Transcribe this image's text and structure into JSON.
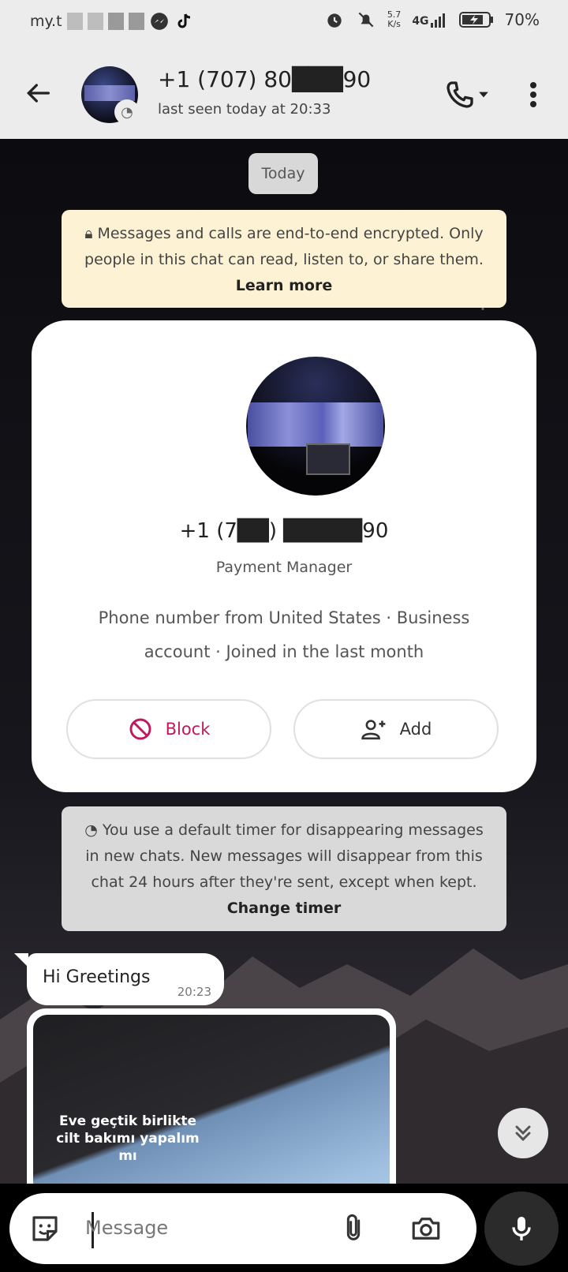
{
  "status_bar": {
    "left_text": "my.t",
    "speed_value": "5.7",
    "speed_unit": "K/s",
    "network": "4G",
    "battery": "70%"
  },
  "header": {
    "contact_name": "+1 (707) 80███90",
    "last_seen": "last seen today at 20:33"
  },
  "chat": {
    "date_chip": "Today",
    "encryption_notice": "Messages and calls are end-to-end encrypted. Only people in this chat can read, listen to, or share them.",
    "encryption_link": "Learn more",
    "contact_card": {
      "phone": "+1 (7██) █████90",
      "role": "Payment Manager",
      "meta_line1": "Phone number from United States  ·  Business",
      "meta_line2": "account  ·  Joined in the last month",
      "block_label": "Block",
      "add_label": "Add"
    },
    "timer_notice": "You use a default timer for disappearing messages in new chats. New messages will disappear from this chat 24 hours after they're sent, except when kept.",
    "timer_link": "Change timer",
    "messages": [
      {
        "text": "Hi Greetings",
        "time": "20:23"
      }
    ],
    "media_caption": "Eve geçtik birlikte cilt bakımı yapalım mı"
  },
  "composer": {
    "placeholder": "Message"
  },
  "colors": {
    "header_bg": "#ececec",
    "encryption_bg": "#fdf3d4",
    "block_red": "#c2185b"
  }
}
